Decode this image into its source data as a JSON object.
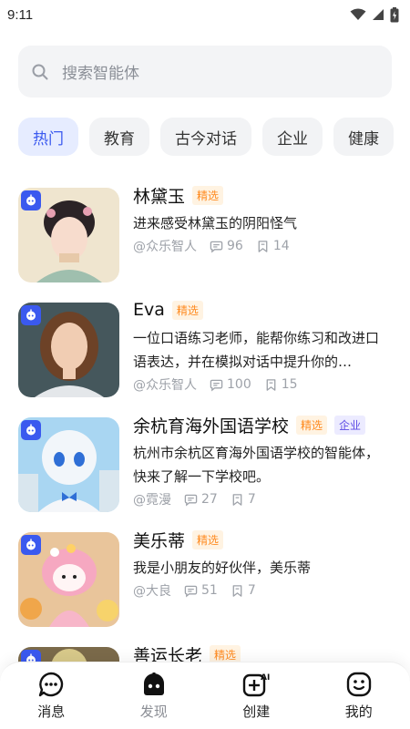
{
  "status": {
    "time": "9:11"
  },
  "search": {
    "placeholder": "搜索智能体"
  },
  "tabs": [
    {
      "label": "热门",
      "active": true
    },
    {
      "label": "教育"
    },
    {
      "label": "古今对话"
    },
    {
      "label": "企业"
    },
    {
      "label": "健康"
    }
  ],
  "agents": [
    {
      "name": "林黛玉",
      "tags": [
        "精选"
      ],
      "desc": "进来感受林黛玉的阴阳怪气",
      "author": "@众乐智人",
      "comments": "96",
      "saves": "14"
    },
    {
      "name": "Eva",
      "tags": [
        "精选"
      ],
      "desc": "一位口语练习老师，能帮你练习和改进口语表达，并在模拟对话中提升你的…",
      "author": "@众乐智人",
      "comments": "100",
      "saves": "15"
    },
    {
      "name": "余杭育海外国语学校",
      "tags": [
        "精选",
        "企业"
      ],
      "desc": "杭州市余杭区育海外国语学校的智能体，快来了解一下学校吧。",
      "author": "@霓漫",
      "comments": "27",
      "saves": "7"
    },
    {
      "name": "美乐蒂",
      "tags": [
        "精选"
      ],
      "desc": "我是小朋友的好伙伴，美乐蒂",
      "author": "@大良",
      "comments": "51",
      "saves": "7"
    },
    {
      "name": "善运长老",
      "tags": [
        "精选"
      ]
    }
  ],
  "nav": [
    {
      "label": "消息",
      "icon": "chat-bubble-icon"
    },
    {
      "label": "发现",
      "icon": "robot-icon",
      "active": true
    },
    {
      "label": "创建",
      "icon": "ai-create-icon"
    },
    {
      "label": "我的",
      "icon": "smiley-face-icon"
    }
  ],
  "colors": {
    "accent": "#3a59ef",
    "featured": "#ff8a1f",
    "enterprise": "#5b49e4"
  }
}
